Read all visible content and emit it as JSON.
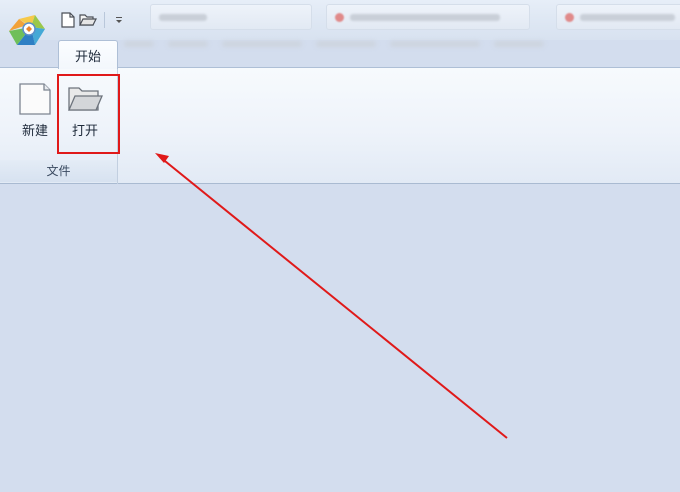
{
  "qat": {
    "items": [
      "new-document",
      "open-folder",
      "customize-dropdown"
    ]
  },
  "ribbon": {
    "active_tab": "开始",
    "groups": [
      {
        "label": "文件",
        "buttons": [
          {
            "label": "新建"
          },
          {
            "label": "打开"
          }
        ]
      }
    ]
  },
  "annotation": {
    "highlight_color": "#e01919"
  }
}
